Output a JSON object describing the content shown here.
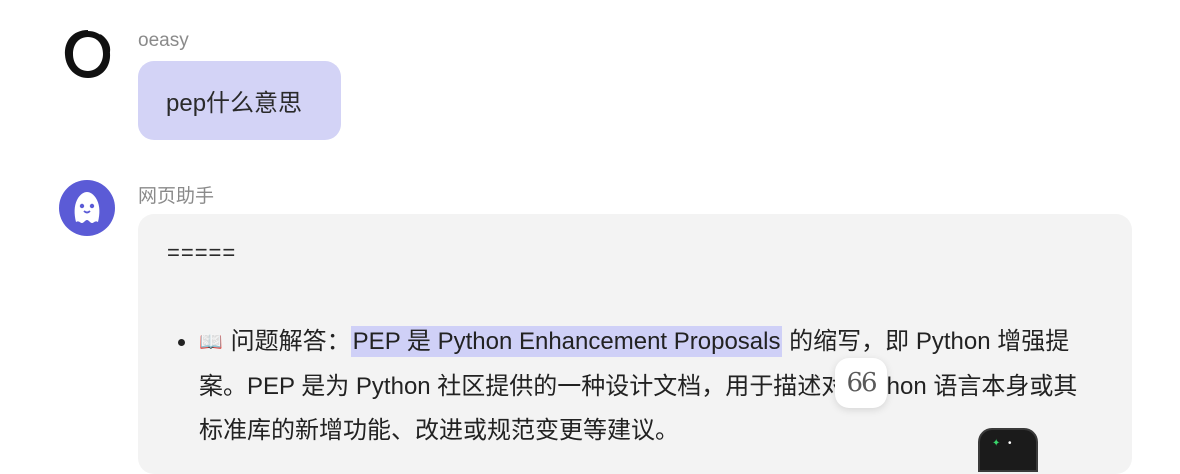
{
  "messages": {
    "user": {
      "sender": "oeasy",
      "text": "pep什么意思",
      "avatar_icon": "brush-circle-icon"
    },
    "assistant": {
      "sender": "网页助手",
      "avatar_icon": "ghost-mascot-icon",
      "separator": "=====",
      "bullet_icon": "📖",
      "bullet_label": "问题解答：",
      "highlight": "PEP 是 Python Enhancement Proposals",
      "body_1": " 的缩写，即 Python 增强提案。PEP 是为 Python 社区提供的一种设计文档，用",
      "body_hidden": "于描",
      "body_2": "述对 Python 语言本身或其标准库的新增功能、改进或规范变更等建议。"
    }
  },
  "selection_popup": {
    "quote_label": "66",
    "icon": "quote-icon"
  },
  "floating_widget": {
    "icon": "sparkle-icon"
  },
  "colors": {
    "user_bubble": "#d3d3f6",
    "assistant_bubble": "#f3f3f3",
    "highlight": "#cfd0f7",
    "bot_avatar": "#5b5bd6"
  }
}
